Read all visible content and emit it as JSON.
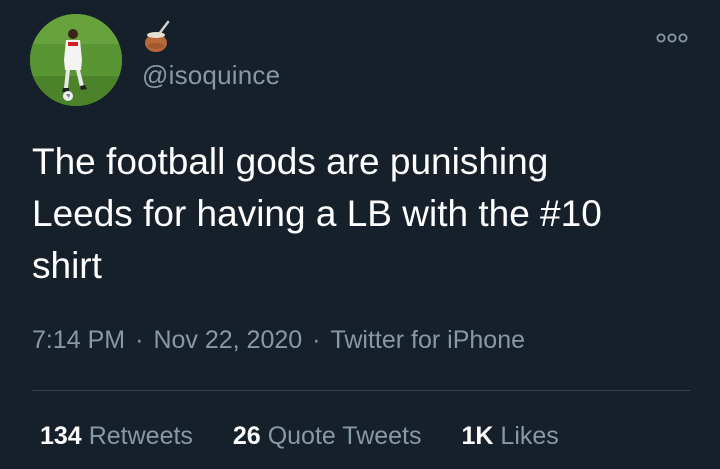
{
  "tweet": {
    "handle": "@isoquince",
    "display_name_icon": "mate-gourd-icon",
    "text": "The football gods are punishing\nLeeds for having a LB with the #10\nshirt",
    "time": "7:14 PM",
    "date": "Nov 22, 2020",
    "separator": "·",
    "source": "Twitter for iPhone",
    "stats": {
      "retweets_count": "134",
      "retweets_label": "Retweets",
      "quote_count": "26",
      "quote_label": "Quote Tweets",
      "likes_count": "1K",
      "likes_label": "Likes"
    }
  },
  "colors": {
    "background": "#15202b",
    "primary_text": "#ffffff",
    "secondary_text": "#8899a6",
    "divider": "#38444d"
  }
}
